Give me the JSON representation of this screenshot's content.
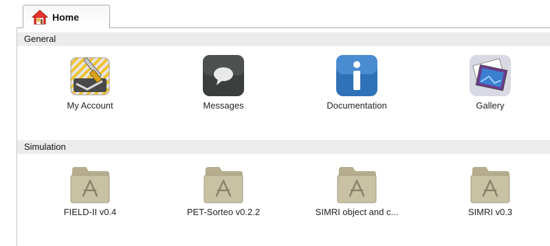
{
  "tab": {
    "label": "Home",
    "icon": "home-icon"
  },
  "sections": [
    {
      "title": "General",
      "items": [
        {
          "label": "My Account",
          "icon": "account-tools-icon"
        },
        {
          "label": "Messages",
          "icon": "speech-bubble-icon"
        },
        {
          "label": "Documentation",
          "icon": "info-icon"
        },
        {
          "label": "Gallery",
          "icon": "photo-gallery-icon"
        }
      ]
    },
    {
      "title": "Simulation",
      "items": [
        {
          "label": "FIELD-II v0.4",
          "icon": "folder-icon"
        },
        {
          "label": "PET-Sorteo v0.2.2",
          "icon": "folder-icon"
        },
        {
          "label": "SIMRI object and c...",
          "icon": "folder-icon"
        },
        {
          "label": "SIMRI v0.3",
          "icon": "folder-icon"
        }
      ]
    }
  ],
  "colors": {
    "section_bg": "#ececec",
    "messages_bg": "#3a3e3d",
    "documentation_bg": "#2f72b8",
    "folder": "#c9c1a3"
  }
}
